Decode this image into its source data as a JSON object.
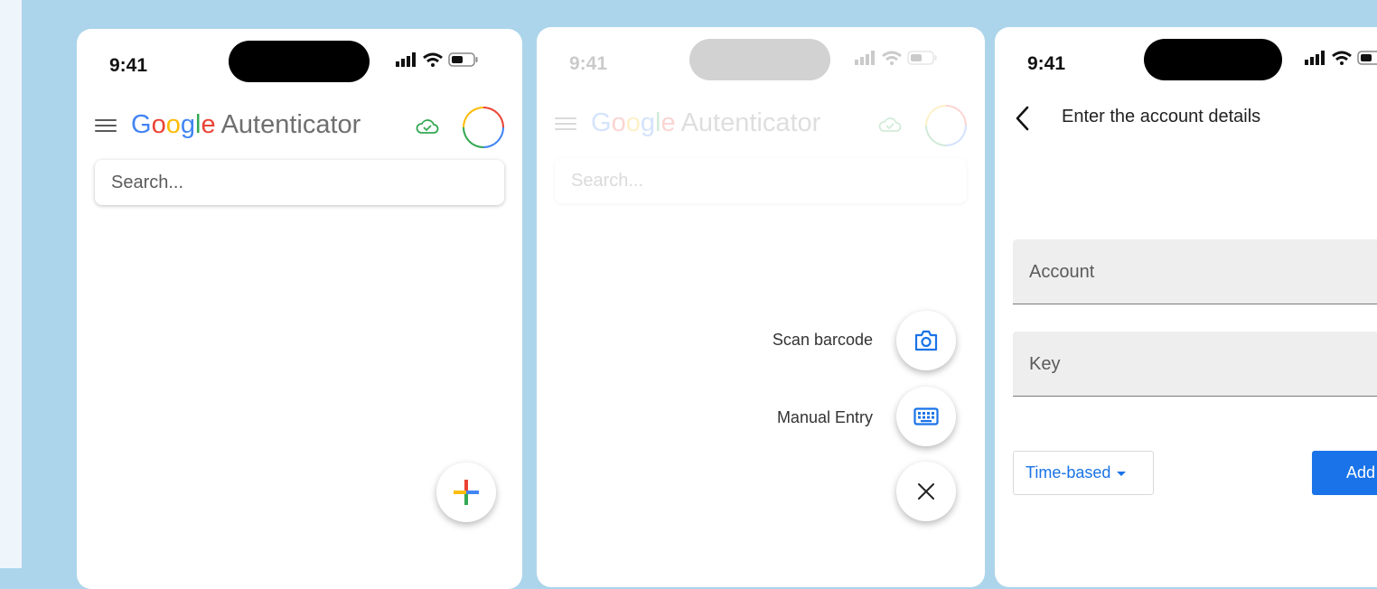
{
  "screens": [
    {
      "time": "9:41",
      "brand": {
        "google": "Google",
        "app": "Autenticator"
      },
      "search_placeholder": "Search..."
    },
    {
      "time": "9:41",
      "brand": {
        "google": "Google",
        "app": "Autenticator"
      },
      "search_placeholder": "Search...",
      "menu": {
        "scan_label": "Scan barcode",
        "manual_label": "Manual Entry"
      }
    },
    {
      "time": "9:41",
      "title": "Enter the account details",
      "account_placeholder": "Account",
      "key_placeholder": "Key",
      "type_select": "Time-based",
      "add_label": "Add"
    }
  ],
  "icons": {
    "menu": "hamburger-icon",
    "sync": "cloud-check-icon",
    "add": "plus-icon",
    "scan": "camera-icon",
    "manual": "keyboard-icon",
    "close": "close-icon",
    "back": "back-arrow-icon"
  },
  "colors": {
    "background": "#acd5eb",
    "accent": "#1a73e8",
    "google_blue": "#4285F4",
    "google_red": "#EA4335",
    "google_yellow": "#FBBC05",
    "google_green": "#34A853"
  }
}
